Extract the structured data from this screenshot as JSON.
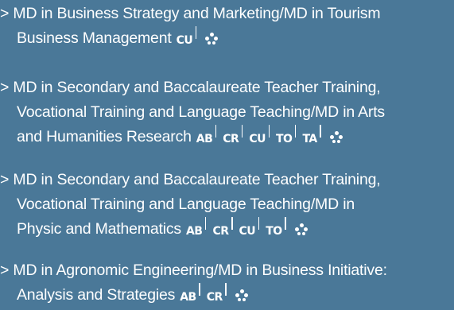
{
  "programs": [
    {
      "lines": [
        "> MD in Business Strategy and Marketing/MD in Tourism",
        "Business Management"
      ],
      "badges": [
        "CU"
      ]
    },
    {
      "lines": [
        "> MD in Secondary and Baccalaureate Teacher Training,",
        "Vocational Training and Language Teaching/MD in Arts",
        "and Humanities Research"
      ],
      "badges": [
        "AB",
        "CR",
        "CU",
        "TO",
        "TA"
      ]
    },
    {
      "lines": [
        "> MD in Secondary and Baccalaureate Teacher Training,",
        "Vocational Training and Language Teaching/MD in",
        "Physic and Mathematics"
      ],
      "badges": [
        "AB",
        "CR",
        "CU",
        "TO"
      ]
    },
    {
      "lines": [
        "> MD in Agronomic Engineering/MD in Business Initiative:",
        "Analysis and Strategies"
      ],
      "badges": [
        "AB",
        "CR"
      ]
    }
  ],
  "colors": {
    "background": "#4a7898",
    "text": "#ffffff"
  },
  "icons": {
    "group": "group-people-icon"
  }
}
